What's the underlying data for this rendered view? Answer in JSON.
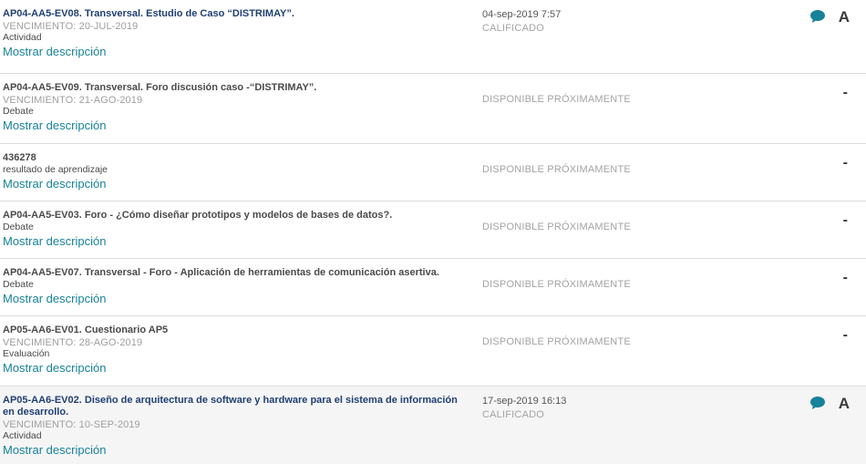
{
  "show_description_label": "Mostrar descripción",
  "colors": {
    "title_link": "#1f3f74",
    "desc_link": "#17829a",
    "chat_icon": "#17829a"
  },
  "activities": [
    {
      "title": "AP04-AA5-EV08. Transversal. Estudio de Caso “DISTRIMAY”.",
      "due": "VENCIMIENTO: 20-JUL-2019",
      "type": "Actividad",
      "date": "04-sep-2019 7:57",
      "status": "CALIFICADO",
      "grade": "A",
      "has_comment": true
    },
    {
      "title": "AP04-AA5-EV09. Transversal. Foro discusión caso -“DISTRIMAY”.",
      "due": "VENCIMIENTO: 21-AGO-2019",
      "type": "Debate",
      "date": "",
      "status": "DISPONIBLE PRÓXIMAMENTE",
      "grade": "-",
      "has_comment": false
    },
    {
      "title": "436278",
      "due": "",
      "type": "resultado de aprendizaje",
      "date": "",
      "status": "DISPONIBLE PRÓXIMAMENTE",
      "grade": "-",
      "has_comment": false
    },
    {
      "title": "AP04-AA5-EV03. Foro - ¿Cómo diseñar prototipos y modelos de bases de datos?.",
      "due": "",
      "type": "Debate",
      "date": "",
      "status": "DISPONIBLE PRÓXIMAMENTE",
      "grade": "-",
      "has_comment": false
    },
    {
      "title": "AP04-AA5-EV07. Transversal - Foro - Aplicación de herramientas de comunicación asertiva.",
      "due": "",
      "type": "Debate",
      "date": "",
      "status": "DISPONIBLE PRÓXIMAMENTE",
      "grade": "-",
      "has_comment": false
    },
    {
      "title": "AP05-AA6-EV01. Cuestionario AP5",
      "due": "VENCIMIENTO: 28-AGO-2019",
      "type": "Evaluación",
      "date": "",
      "status": "DISPONIBLE PRÓXIMAMENTE",
      "grade": "-",
      "has_comment": false
    },
    {
      "title": "AP05-AA6-EV02. Diseño de arquitectura de software y hardware para el sistema de información en desarrollo.",
      "due": "VENCIMIENTO: 10-SEP-2019",
      "type": "Actividad",
      "date": "17-sep-2019 16:13",
      "status": "CALIFICADO",
      "grade": "A",
      "has_comment": true
    }
  ]
}
